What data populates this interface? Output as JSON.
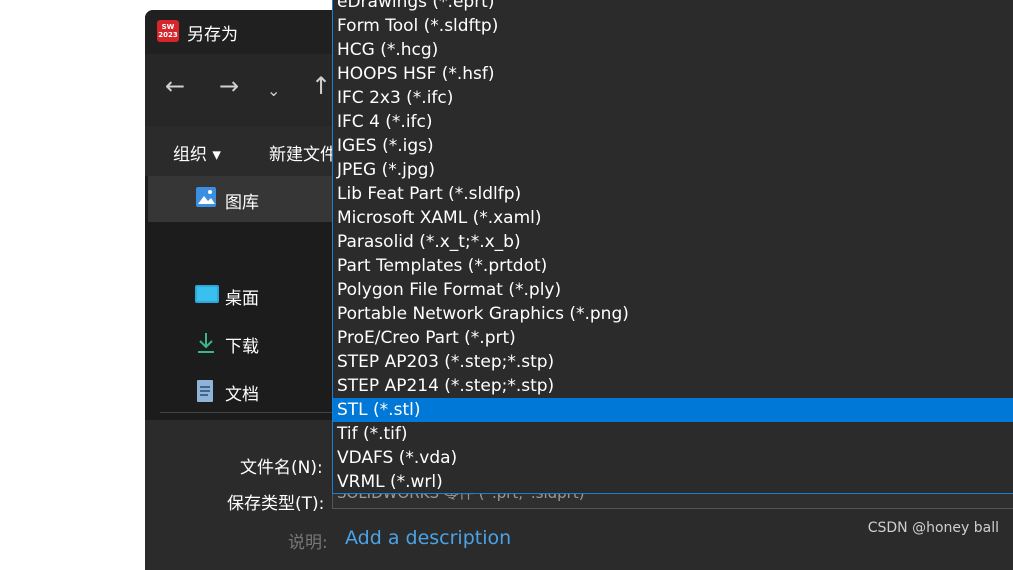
{
  "window": {
    "title": "另存为",
    "app_logo_text": "SW 2023",
    "accent_color": "#0078d7"
  },
  "nav": {
    "back_icon": "arrow-left",
    "forward_icon": "arrow-right",
    "recent_icon": "chevron-down",
    "up_icon": "arrow-up"
  },
  "toolbar": {
    "organize_label": "组织 ▾",
    "new_folder_label": "新建文件"
  },
  "sidebar": {
    "items": [
      {
        "label": "图库",
        "icon": "gallery-icon"
      },
      {
        "label": "桌面",
        "icon": "desktop-icon"
      },
      {
        "label": "下载",
        "icon": "download-icon"
      },
      {
        "label": "文档",
        "icon": "document-icon"
      }
    ]
  },
  "form": {
    "filename_label": "文件名(N):",
    "type_label": "保存类型(T):",
    "type_value": "SOLIDWORKS 零件 (*.prt;*.sldprt)",
    "description_label": "说明:",
    "description_link": "Add a description"
  },
  "dropdown": {
    "selected_index": 17,
    "options": [
      "eDrawings (*.eprt)",
      "Form Tool (*.sldftp)",
      "HCG (*.hcg)",
      "HOOPS HSF (*.hsf)",
      "IFC 2x3 (*.ifc)",
      "IFC 4 (*.ifc)",
      "IGES (*.igs)",
      "JPEG (*.jpg)",
      "Lib Feat Part (*.sldlfp)",
      "Microsoft XAML (*.xaml)",
      "Parasolid (*.x_t;*.x_b)",
      "Part Templates (*.prtdot)",
      "Polygon File Format (*.ply)",
      "Portable Network Graphics (*.png)",
      "ProE/Creo Part (*.prt)",
      "STEP AP203 (*.step;*.stp)",
      "STEP AP214 (*.step;*.stp)",
      "STL (*.stl)",
      "Tif (*.tif)",
      "VDAFS (*.vda)",
      "VRML (*.wrl)"
    ]
  },
  "watermark": "CSDN @honey ball"
}
